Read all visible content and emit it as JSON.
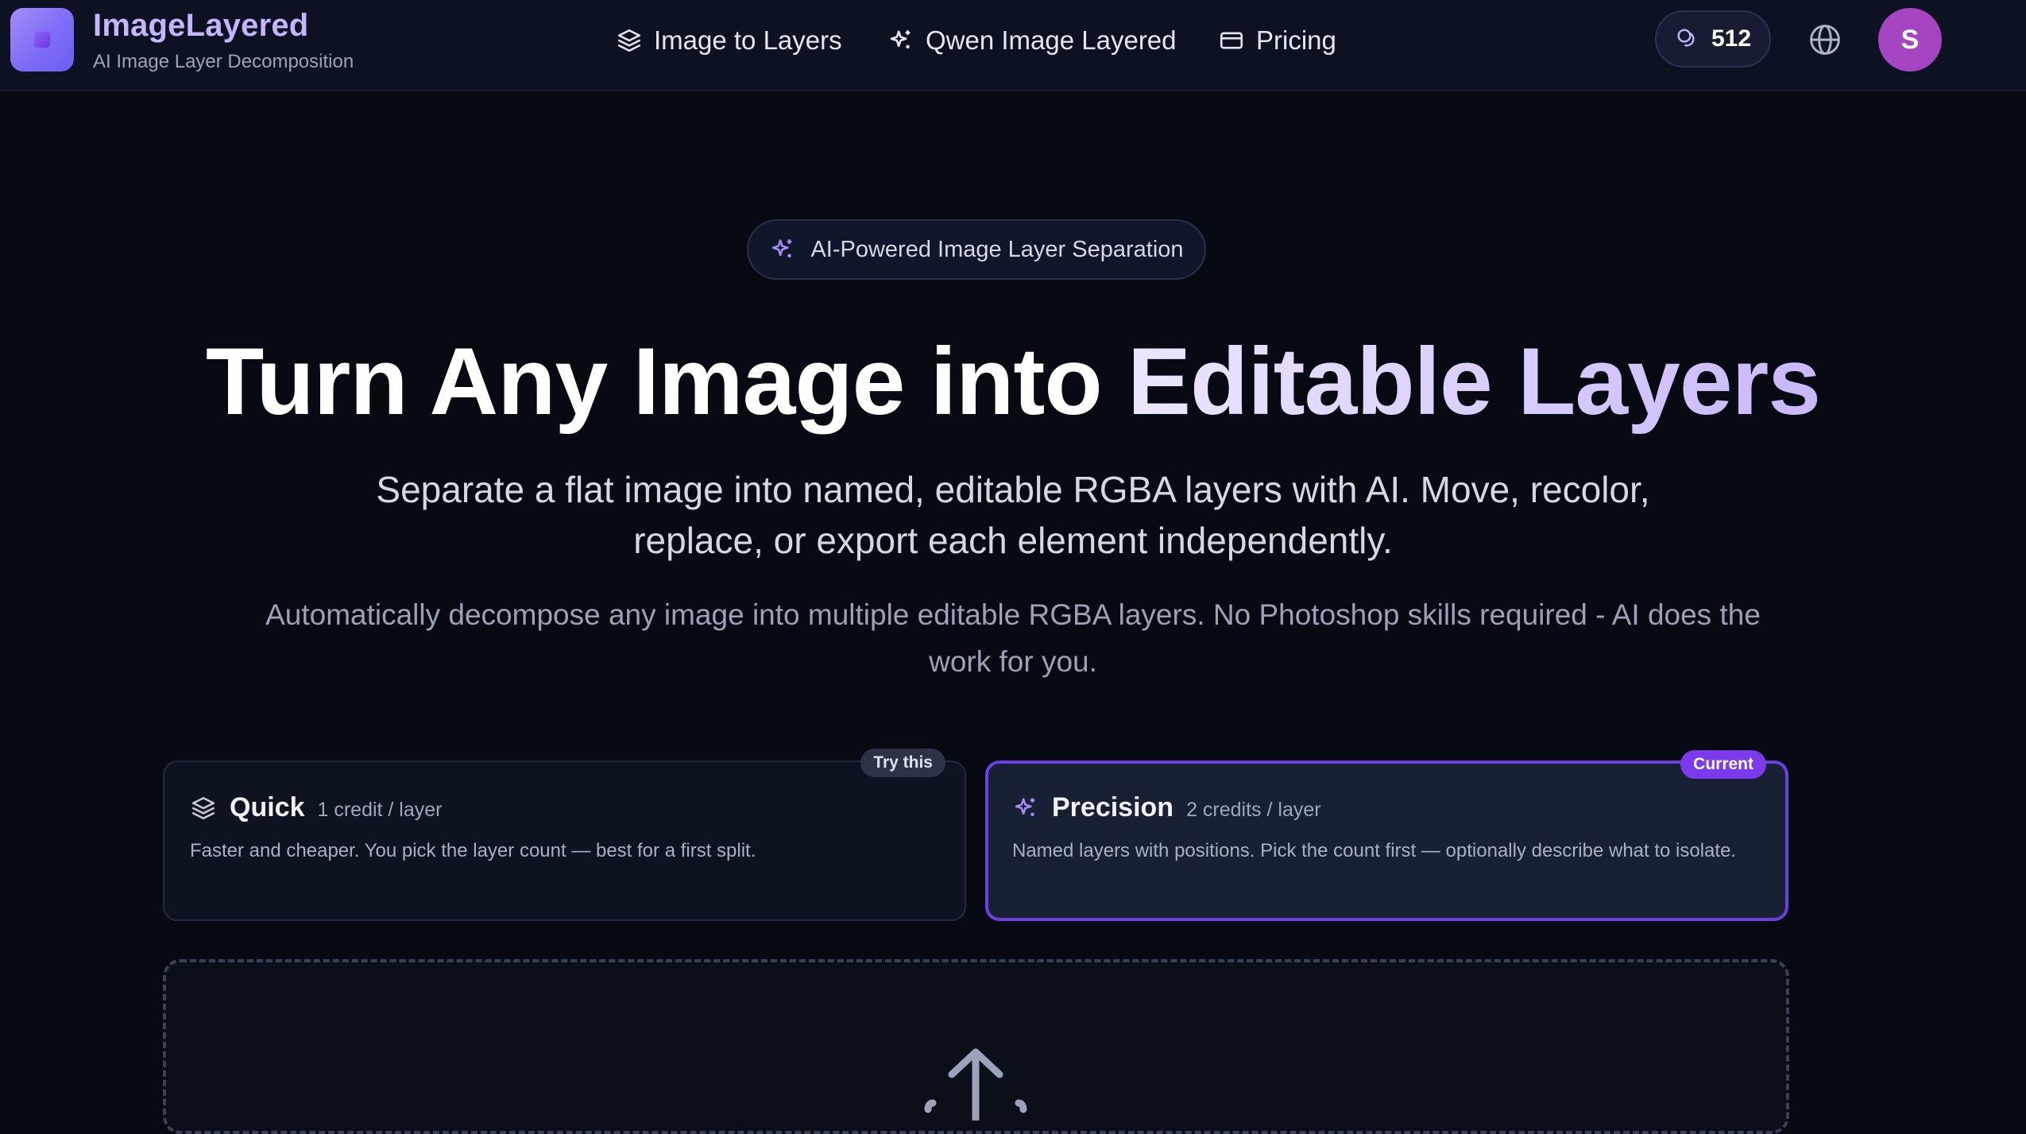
{
  "header": {
    "brand_name": "ImageLayered",
    "brand_tagline": "AI Image Layer Decomposition",
    "nav": [
      {
        "label": "Image to Layers",
        "icon": "layers-icon"
      },
      {
        "label": "Qwen Image Layered",
        "icon": "sparkles-icon"
      },
      {
        "label": "Pricing",
        "icon": "credit-card-icon"
      }
    ],
    "credits": "512",
    "avatar_initial": "S"
  },
  "hero": {
    "badge": "AI-Powered Image Layer Separation",
    "title_main": "Turn Any Image into ",
    "title_accent": "Editable Layers",
    "subtitle": "Separate a flat image into named, editable RGBA layers with AI. Move, recolor, replace, or export each element independently.",
    "description": "Automatically decompose any image into multiple editable RGBA layers. No Photoshop skills required - AI does the work for you."
  },
  "modes": [
    {
      "name": "Quick",
      "cost": "1 credit / layer",
      "description": "Faster and cheaper. You pick the layer count — best for a first split.",
      "tag": "Try this",
      "icon": "layers-icon"
    },
    {
      "name": "Precision",
      "cost": "2 credits / layer",
      "description": "Named layers with positions. Pick the count first — optionally describe what to isolate.",
      "tag": "Current",
      "icon": "sparkles-icon",
      "selected": true
    }
  ],
  "colors": {
    "accent": "#7c3aed",
    "brand": "#c4b5fd",
    "avatar": "#a545c2",
    "background": "#070a12"
  }
}
